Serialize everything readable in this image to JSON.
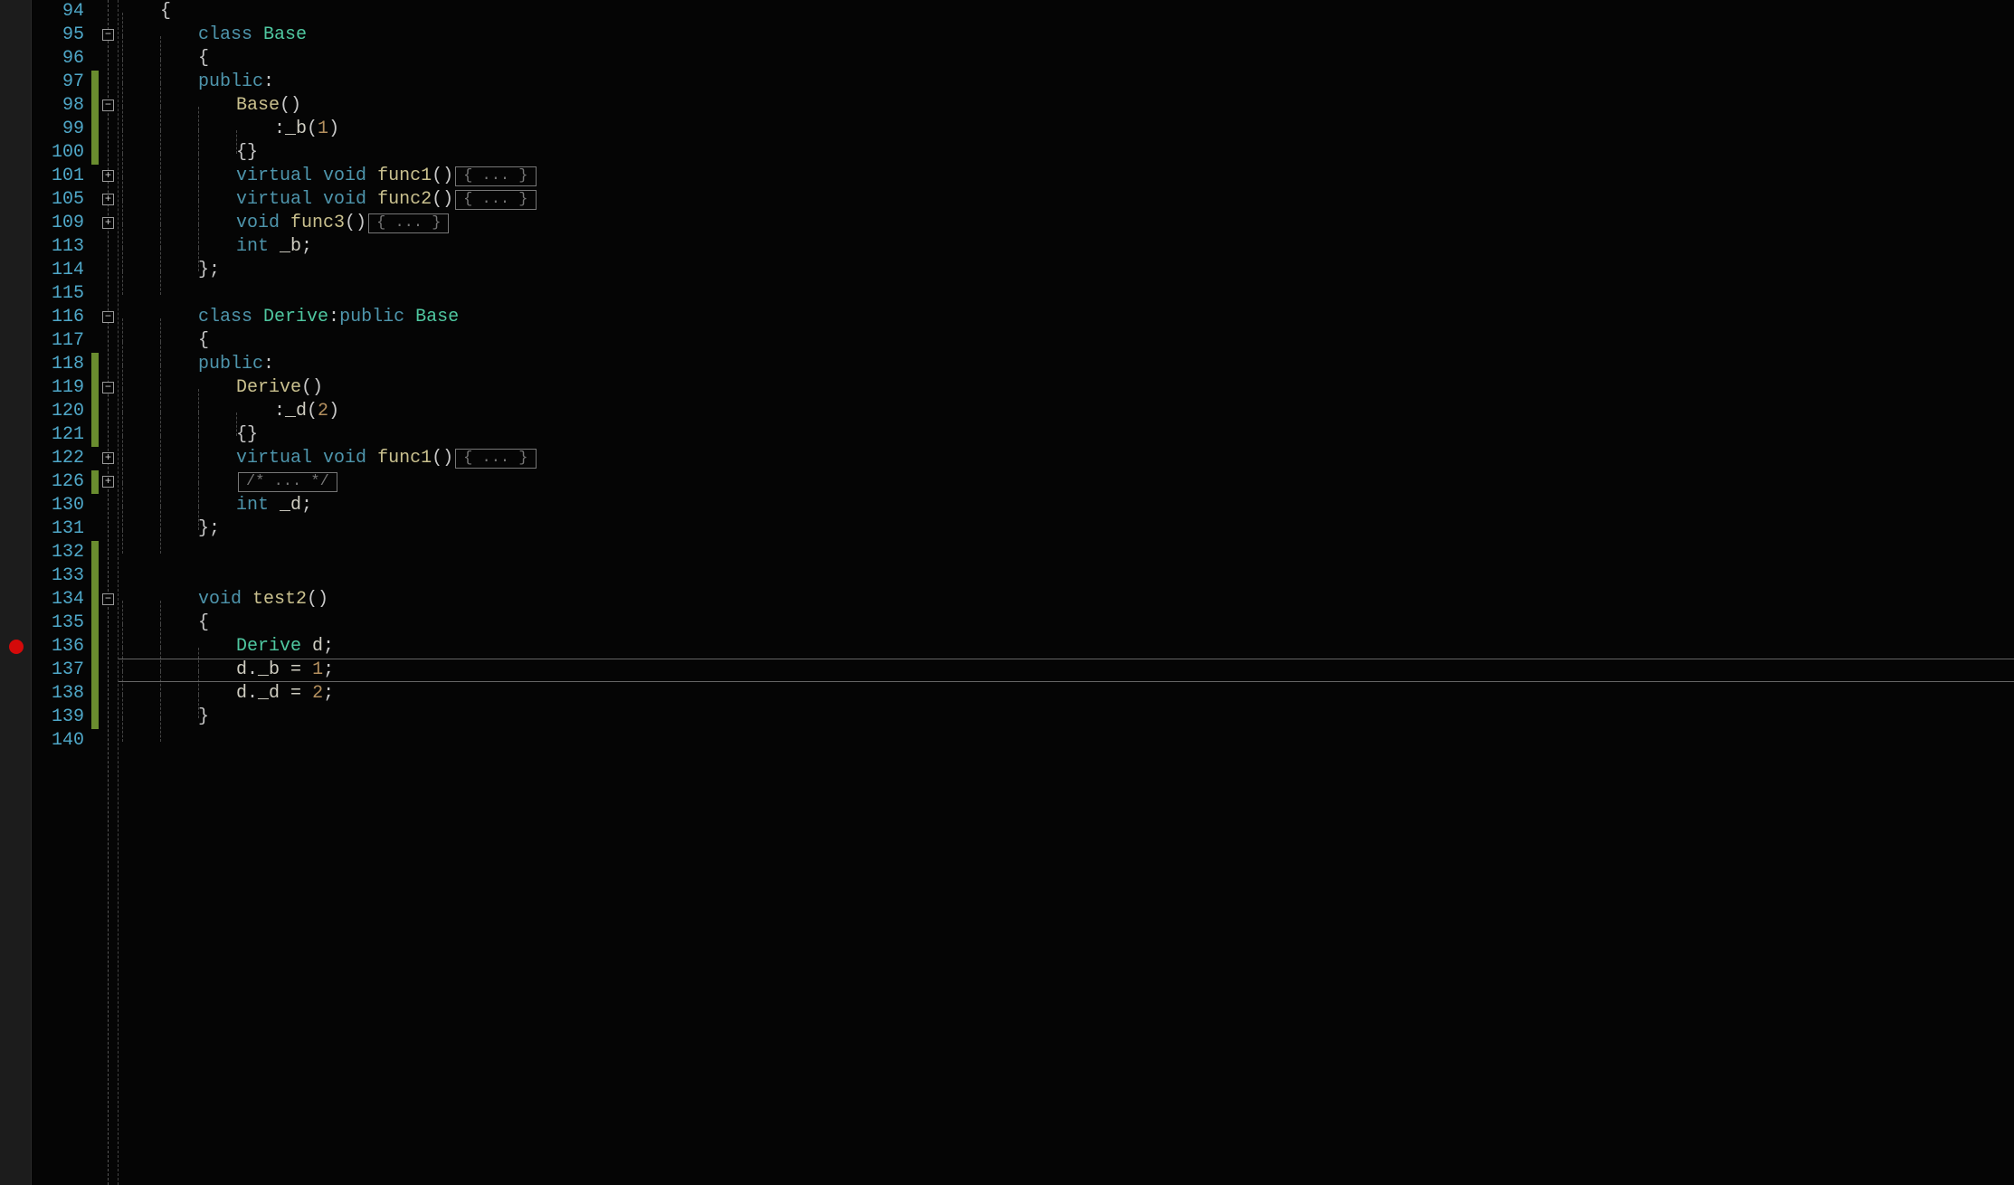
{
  "lines": [
    {
      "num": 94,
      "fold": null,
      "change": false,
      "bp": false,
      "tokens": [
        {
          "t": "{",
          "c": "punct",
          "ind": 1
        }
      ]
    },
    {
      "num": 95,
      "fold": "minus",
      "change": false,
      "bp": false,
      "tokens": [
        {
          "t": "class",
          "c": "keyword",
          "ind": 2
        },
        {
          "t": " ",
          "c": "default"
        },
        {
          "t": "Base",
          "c": "class"
        }
      ]
    },
    {
      "num": 96,
      "fold": null,
      "change": false,
      "bp": false,
      "tokens": [
        {
          "t": "{",
          "c": "punct",
          "ind": 2
        }
      ]
    },
    {
      "num": 97,
      "fold": null,
      "change": true,
      "bp": false,
      "tokens": [
        {
          "t": "public",
          "c": "keyword",
          "ind": 2
        },
        {
          "t": ":",
          "c": "punct"
        }
      ]
    },
    {
      "num": 98,
      "fold": "minus",
      "change": true,
      "bp": false,
      "tokens": [
        {
          "t": "Base",
          "c": "func",
          "ind": 3
        },
        {
          "t": "()",
          "c": "punct"
        }
      ]
    },
    {
      "num": 99,
      "fold": null,
      "change": true,
      "bp": false,
      "tokens": [
        {
          "t": ":",
          "c": "punct",
          "ind": 4
        },
        {
          "t": "_b",
          "c": "ident"
        },
        {
          "t": "(",
          "c": "punct"
        },
        {
          "t": "1",
          "c": "num"
        },
        {
          "t": ")",
          "c": "punct"
        }
      ]
    },
    {
      "num": 100,
      "fold": null,
      "change": true,
      "bp": false,
      "tokens": [
        {
          "t": "{}",
          "c": "punct",
          "ind": 3
        }
      ]
    },
    {
      "num": 101,
      "fold": "plus",
      "change": false,
      "bp": false,
      "tokens": [
        {
          "t": "virtual",
          "c": "keyword",
          "ind": 3
        },
        {
          "t": " ",
          "c": "default"
        },
        {
          "t": "void",
          "c": "type"
        },
        {
          "t": " ",
          "c": "default"
        },
        {
          "t": "func1",
          "c": "func"
        },
        {
          "t": "()",
          "c": "punct"
        },
        {
          "pill": "{ ... }"
        }
      ]
    },
    {
      "num": 105,
      "fold": "plus",
      "change": false,
      "bp": false,
      "tokens": [
        {
          "t": "virtual",
          "c": "keyword",
          "ind": 3
        },
        {
          "t": " ",
          "c": "default"
        },
        {
          "t": "void",
          "c": "type"
        },
        {
          "t": " ",
          "c": "default"
        },
        {
          "t": "func2",
          "c": "func"
        },
        {
          "t": "()",
          "c": "punct"
        },
        {
          "pill": "{ ... }"
        }
      ]
    },
    {
      "num": 109,
      "fold": "plus",
      "change": false,
      "bp": false,
      "tokens": [
        {
          "t": "void",
          "c": "type",
          "ind": 3
        },
        {
          "t": " ",
          "c": "default"
        },
        {
          "t": "func3",
          "c": "func"
        },
        {
          "t": "()",
          "c": "punct"
        },
        {
          "pill": "{ ... }"
        }
      ]
    },
    {
      "num": 113,
      "fold": null,
      "change": false,
      "bp": false,
      "tokens": [
        {
          "t": "int",
          "c": "type",
          "ind": 3
        },
        {
          "t": " ",
          "c": "default"
        },
        {
          "t": "_b",
          "c": "ident"
        },
        {
          "t": ";",
          "c": "punct"
        }
      ]
    },
    {
      "num": 114,
      "fold": null,
      "change": false,
      "bp": false,
      "tokens": [
        {
          "t": "};",
          "c": "punct",
          "ind": 2
        }
      ]
    },
    {
      "num": 115,
      "fold": null,
      "change": false,
      "bp": false,
      "tokens": []
    },
    {
      "num": 116,
      "fold": "minus",
      "change": false,
      "bp": false,
      "tokens": [
        {
          "t": "class",
          "c": "keyword",
          "ind": 2
        },
        {
          "t": " ",
          "c": "default"
        },
        {
          "t": "Derive",
          "c": "class"
        },
        {
          "t": ":",
          "c": "punct"
        },
        {
          "t": "public",
          "c": "keyword"
        },
        {
          "t": " ",
          "c": "default"
        },
        {
          "t": "Base",
          "c": "class"
        }
      ]
    },
    {
      "num": 117,
      "fold": null,
      "change": false,
      "bp": false,
      "tokens": [
        {
          "t": "{",
          "c": "punct",
          "ind": 2
        }
      ]
    },
    {
      "num": 118,
      "fold": null,
      "change": true,
      "bp": false,
      "tokens": [
        {
          "t": "public",
          "c": "keyword",
          "ind": 2
        },
        {
          "t": ":",
          "c": "punct"
        }
      ]
    },
    {
      "num": 119,
      "fold": "minus",
      "change": true,
      "bp": false,
      "tokens": [
        {
          "t": "Derive",
          "c": "func",
          "ind": 3
        },
        {
          "t": "()",
          "c": "punct"
        }
      ]
    },
    {
      "num": 120,
      "fold": null,
      "change": true,
      "bp": false,
      "tokens": [
        {
          "t": ":",
          "c": "punct",
          "ind": 4
        },
        {
          "t": "_d",
          "c": "ident"
        },
        {
          "t": "(",
          "c": "punct"
        },
        {
          "t": "2",
          "c": "num"
        },
        {
          "t": ")",
          "c": "punct"
        }
      ]
    },
    {
      "num": 121,
      "fold": null,
      "change": true,
      "bp": false,
      "tokens": [
        {
          "t": "{}",
          "c": "punct",
          "ind": 3
        }
      ]
    },
    {
      "num": 122,
      "fold": "plus",
      "change": false,
      "bp": false,
      "tokens": [
        {
          "t": "virtual",
          "c": "keyword",
          "ind": 3
        },
        {
          "t": " ",
          "c": "default"
        },
        {
          "t": "void",
          "c": "type"
        },
        {
          "t": " ",
          "c": "default"
        },
        {
          "t": "func1",
          "c": "func"
        },
        {
          "t": "()",
          "c": "punct"
        },
        {
          "pill": "{ ... }"
        }
      ]
    },
    {
      "num": 126,
      "fold": "plus",
      "change": true,
      "bp": false,
      "tokens": [
        {
          "t": "",
          "c": "default",
          "ind": 3
        },
        {
          "pill": "/* ... */"
        }
      ]
    },
    {
      "num": 130,
      "fold": null,
      "change": false,
      "bp": false,
      "tokens": [
        {
          "t": "int",
          "c": "type",
          "ind": 3
        },
        {
          "t": " ",
          "c": "default"
        },
        {
          "t": "_d",
          "c": "ident"
        },
        {
          "t": ";",
          "c": "punct"
        }
      ]
    },
    {
      "num": 131,
      "fold": null,
      "change": false,
      "bp": false,
      "tokens": [
        {
          "t": "};",
          "c": "punct",
          "ind": 2
        }
      ]
    },
    {
      "num": 132,
      "fold": null,
      "change": true,
      "bp": false,
      "tokens": []
    },
    {
      "num": 133,
      "fold": null,
      "change": true,
      "bp": false,
      "tokens": []
    },
    {
      "num": 134,
      "fold": "minus",
      "change": true,
      "bp": false,
      "tokens": [
        {
          "t": "void",
          "c": "type",
          "ind": 2
        },
        {
          "t": " ",
          "c": "default"
        },
        {
          "t": "test2",
          "c": "func"
        },
        {
          "t": "()",
          "c": "punct"
        }
      ]
    },
    {
      "num": 135,
      "fold": null,
      "change": true,
      "bp": false,
      "tokens": [
        {
          "t": "{",
          "c": "punct",
          "ind": 2
        }
      ]
    },
    {
      "num": 136,
      "fold": null,
      "change": true,
      "bp": true,
      "tokens": [
        {
          "t": "Derive",
          "c": "class",
          "ind": 3
        },
        {
          "t": " ",
          "c": "default"
        },
        {
          "t": "d",
          "c": "ident"
        },
        {
          "t": ";",
          "c": "punct"
        }
      ]
    },
    {
      "num": 137,
      "fold": null,
      "change": true,
      "bp": false,
      "cursor": true,
      "tokens": [
        {
          "t": "d",
          "c": "ident",
          "ind": 3
        },
        {
          "t": ".",
          "c": "punct"
        },
        {
          "t": "_b",
          "c": "ident"
        },
        {
          "t": " = ",
          "c": "default"
        },
        {
          "t": "1",
          "c": "num"
        },
        {
          "t": ";",
          "c": "punct"
        }
      ]
    },
    {
      "num": 138,
      "fold": null,
      "change": true,
      "bp": false,
      "tokens": [
        {
          "t": "d",
          "c": "ident",
          "ind": 3
        },
        {
          "t": ".",
          "c": "punct"
        },
        {
          "t": "_d",
          "c": "ident"
        },
        {
          "t": " = ",
          "c": "default"
        },
        {
          "t": "2",
          "c": "num"
        },
        {
          "t": ";",
          "c": "punct"
        }
      ]
    },
    {
      "num": 139,
      "fold": null,
      "change": true,
      "bp": false,
      "tokens": [
        {
          "t": "}",
          "c": "punct",
          "ind": 2
        }
      ]
    },
    {
      "num": 140,
      "fold": null,
      "change": false,
      "bp": false,
      "tokens": []
    }
  ],
  "indent_width": 42,
  "line_height": 26
}
